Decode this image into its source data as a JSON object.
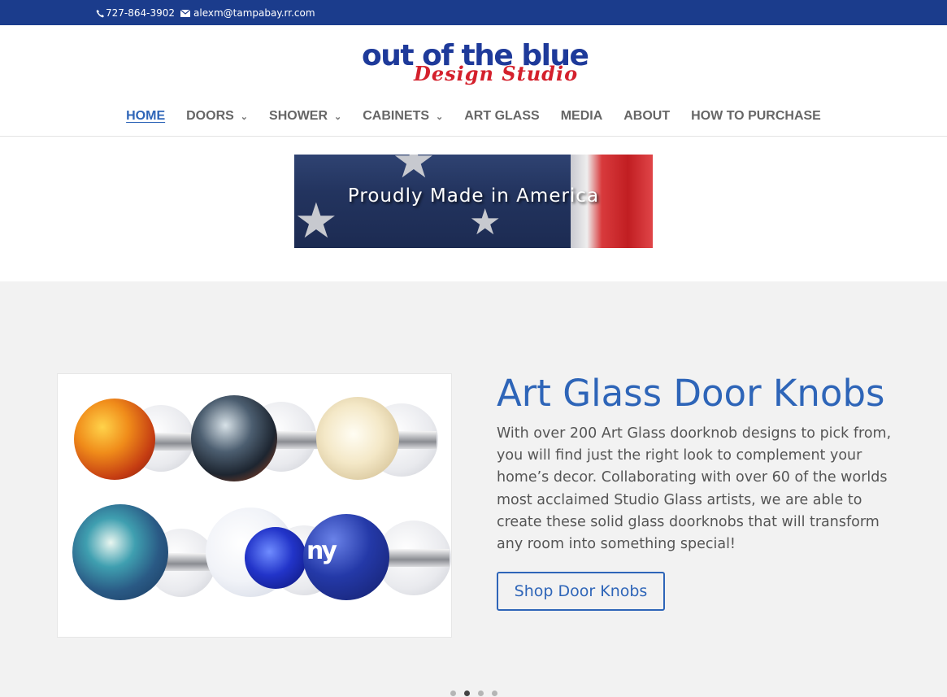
{
  "topbar": {
    "phone": "727-864-3902",
    "email": "alexm@tampabay.rr.com",
    "bg_color": "#1b3c8c"
  },
  "logo": {
    "line1": "out of the blue",
    "line2": "Design Studio"
  },
  "nav": {
    "items": [
      {
        "label": "HOME",
        "active": true,
        "has_dropdown": false
      },
      {
        "label": "DOORS",
        "active": false,
        "has_dropdown": true
      },
      {
        "label": "SHOWER",
        "active": false,
        "has_dropdown": true
      },
      {
        "label": "CABINETS",
        "active": false,
        "has_dropdown": true
      },
      {
        "label": "ART GLASS",
        "active": false,
        "has_dropdown": false
      },
      {
        "label": "MEDIA",
        "active": false,
        "has_dropdown": false
      },
      {
        "label": "ABOUT",
        "active": false,
        "has_dropdown": false
      },
      {
        "label": "HOW TO PURCHASE",
        "active": false,
        "has_dropdown": false
      }
    ],
    "active_color": "#2e65b8",
    "dropdown_icon": "chevron-down-icon"
  },
  "banner": {
    "title": "Proudly Made in America"
  },
  "slide": {
    "title": "Art Glass Door Knobs",
    "text": "With over 200 Art Glass doorknob designs to pick from, you will find just the right look to complement your home’s decor. Collaborating with over 60 of the worlds most acclaimed Studio Glass artists, we are able to create these solid glass doorknobs that will transform any room into something special!",
    "button_label": "Shop Door Knobs",
    "knob_logo_text": "ny",
    "accent_color": "#2e65b8"
  },
  "slider_dots": {
    "count": 4,
    "active_index": 1
  }
}
